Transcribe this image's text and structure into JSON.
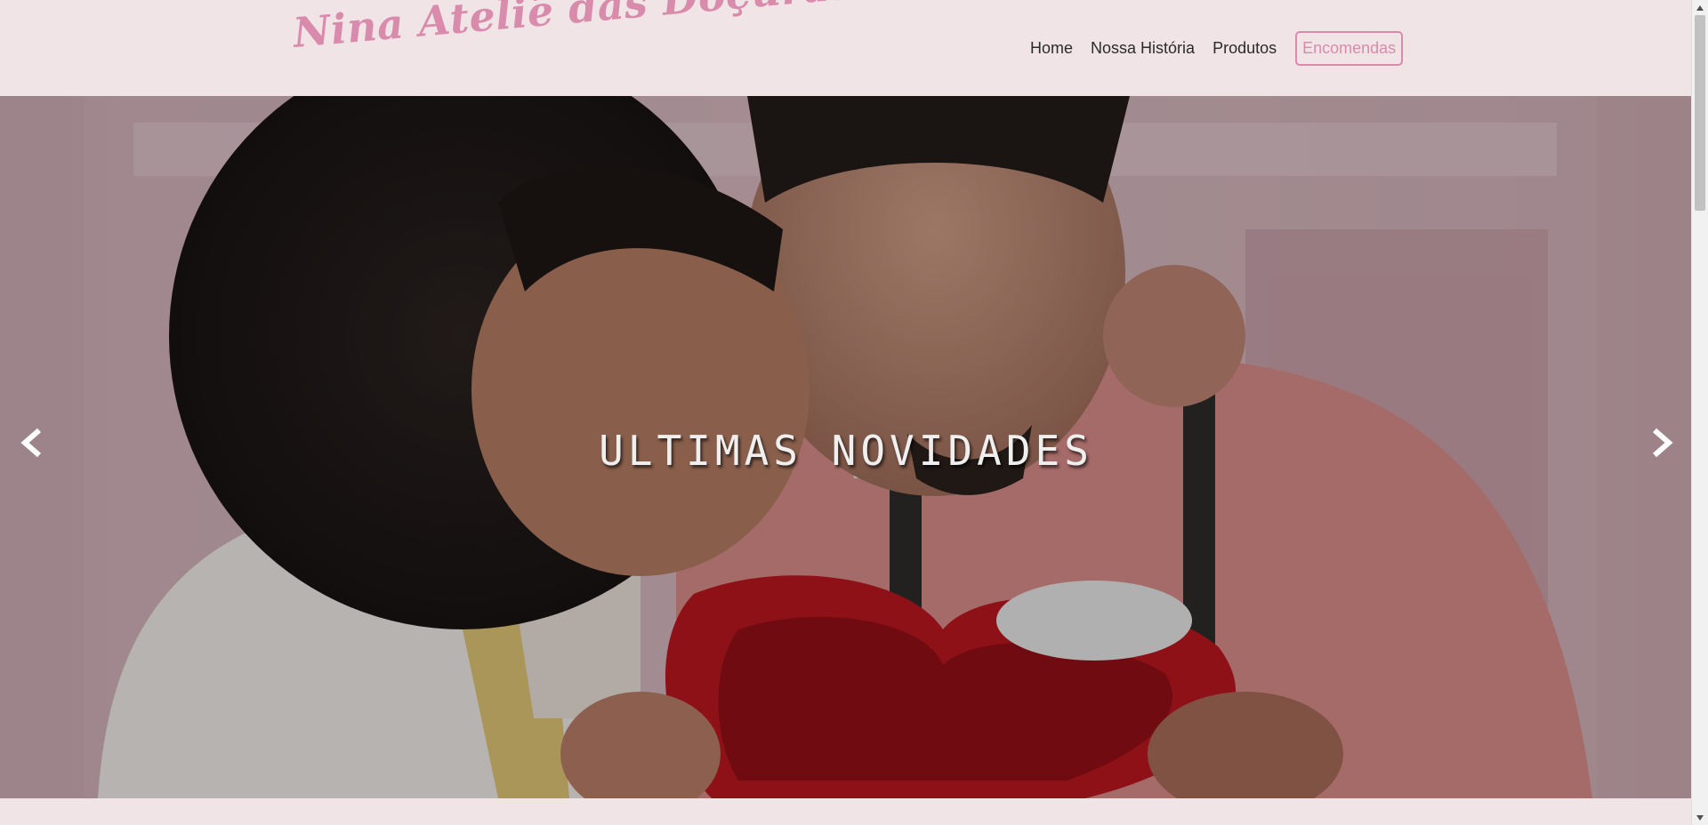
{
  "header": {
    "logo_text": "Nina Ateliê das Doçuras",
    "nav": {
      "home": "Home",
      "story": "Nossa História",
      "products": "Produtos",
      "orders": "Encomendas"
    }
  },
  "hero": {
    "title": "ULTIMAS NOVIDADES",
    "prev_icon": "chevron-left-icon",
    "next_icon": "chevron-right-icon"
  },
  "colors": {
    "accent": "#d98bab",
    "header_bg": "#f0e4e6",
    "nav_text": "#2b2b2b"
  }
}
